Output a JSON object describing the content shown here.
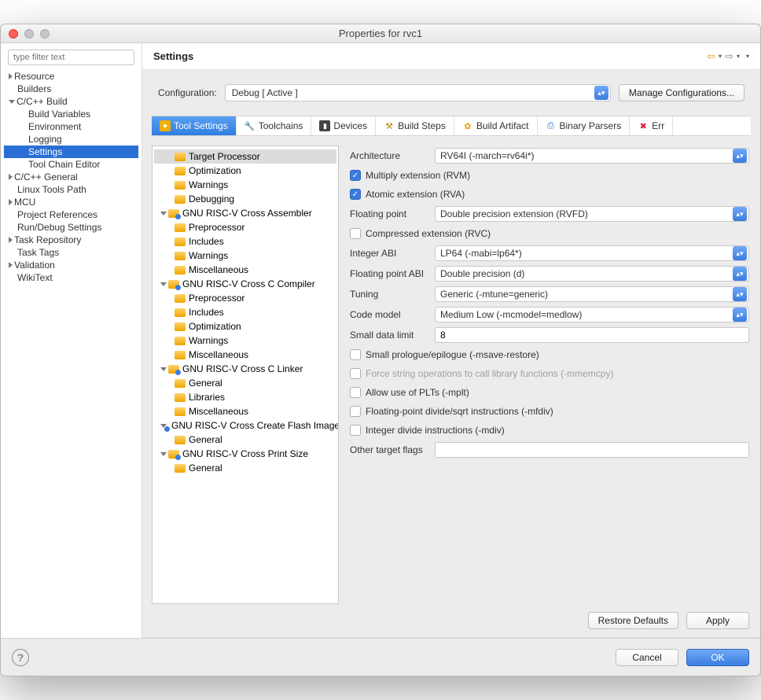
{
  "window": {
    "title": "Properties for rvc1"
  },
  "filter_placeholder": "type filter text",
  "left_tree": [
    {
      "label": "Resource",
      "indent": 0,
      "tri": "r"
    },
    {
      "label": "Builders",
      "indent": 0,
      "tri": "sp"
    },
    {
      "label": "C/C++ Build",
      "indent": 0,
      "tri": "d"
    },
    {
      "label": "Build Variables",
      "indent": 1,
      "tri": "sp"
    },
    {
      "label": "Environment",
      "indent": 1,
      "tri": "sp"
    },
    {
      "label": "Logging",
      "indent": 1,
      "tri": "sp"
    },
    {
      "label": "Settings",
      "indent": 1,
      "tri": "sp",
      "selected": true
    },
    {
      "label": "Tool Chain Editor",
      "indent": 1,
      "tri": "sp"
    },
    {
      "label": "C/C++ General",
      "indent": 0,
      "tri": "r"
    },
    {
      "label": "Linux Tools Path",
      "indent": 0,
      "tri": "sp"
    },
    {
      "label": "MCU",
      "indent": 0,
      "tri": "r"
    },
    {
      "label": "Project References",
      "indent": 0,
      "tri": "sp"
    },
    {
      "label": "Run/Debug Settings",
      "indent": 0,
      "tri": "sp"
    },
    {
      "label": "Task Repository",
      "indent": 0,
      "tri": "r"
    },
    {
      "label": "Task Tags",
      "indent": 0,
      "tri": "sp"
    },
    {
      "label": "Validation",
      "indent": 0,
      "tri": "r"
    },
    {
      "label": "WikiText",
      "indent": 0,
      "tri": "sp"
    }
  ],
  "page_title": "Settings",
  "config": {
    "label": "Configuration:",
    "value": "Debug  [ Active ]",
    "manage": "Manage Configurations..."
  },
  "tabs": [
    {
      "label": "Tool Settings",
      "ico": "tools",
      "active": true
    },
    {
      "label": "Toolchains",
      "ico": "wrench"
    },
    {
      "label": "Devices",
      "ico": "device"
    },
    {
      "label": "Build Steps",
      "ico": "hammer"
    },
    {
      "label": "Build Artifact",
      "ico": "art"
    },
    {
      "label": "Binary Parsers",
      "ico": "bin"
    },
    {
      "label": "Err",
      "ico": "err"
    }
  ],
  "mid_tree": [
    {
      "label": "Target Processor",
      "indent": 1,
      "ico": "f",
      "sel": true
    },
    {
      "label": "Optimization",
      "indent": 1,
      "ico": "f"
    },
    {
      "label": "Warnings",
      "indent": 1,
      "ico": "f"
    },
    {
      "label": "Debugging",
      "indent": 1,
      "ico": "f"
    },
    {
      "label": "GNU RISC-V Cross Assembler",
      "indent": 0,
      "ico": "b",
      "tri": "d"
    },
    {
      "label": "Preprocessor",
      "indent": 1,
      "ico": "f"
    },
    {
      "label": "Includes",
      "indent": 1,
      "ico": "f"
    },
    {
      "label": "Warnings",
      "indent": 1,
      "ico": "f"
    },
    {
      "label": "Miscellaneous",
      "indent": 1,
      "ico": "f"
    },
    {
      "label": "GNU RISC-V Cross C Compiler",
      "indent": 0,
      "ico": "b",
      "tri": "d"
    },
    {
      "label": "Preprocessor",
      "indent": 1,
      "ico": "f"
    },
    {
      "label": "Includes",
      "indent": 1,
      "ico": "f"
    },
    {
      "label": "Optimization",
      "indent": 1,
      "ico": "f"
    },
    {
      "label": "Warnings",
      "indent": 1,
      "ico": "f"
    },
    {
      "label": "Miscellaneous",
      "indent": 1,
      "ico": "f"
    },
    {
      "label": "GNU RISC-V Cross C Linker",
      "indent": 0,
      "ico": "b",
      "tri": "d"
    },
    {
      "label": "General",
      "indent": 1,
      "ico": "f"
    },
    {
      "label": "Libraries",
      "indent": 1,
      "ico": "f"
    },
    {
      "label": "Miscellaneous",
      "indent": 1,
      "ico": "f"
    },
    {
      "label": "GNU RISC-V Cross Create Flash Image",
      "indent": 0,
      "ico": "b",
      "tri": "d"
    },
    {
      "label": "General",
      "indent": 1,
      "ico": "f"
    },
    {
      "label": "GNU RISC-V Cross Print Size",
      "indent": 0,
      "ico": "b",
      "tri": "d"
    },
    {
      "label": "General",
      "indent": 1,
      "ico": "f"
    }
  ],
  "form": {
    "architecture": {
      "label": "Architecture",
      "value": "RV64I (-march=rv64i*)"
    },
    "multiply": {
      "label": "Multiply extension (RVM)",
      "checked": true
    },
    "atomic": {
      "label": "Atomic extension (RVA)",
      "checked": true
    },
    "floating": {
      "label": "Floating point",
      "value": "Double precision extension (RVFD)"
    },
    "compressed": {
      "label": "Compressed extension (RVC)",
      "checked": false
    },
    "iabi": {
      "label": "Integer ABI",
      "value": "LP64 (-mabi=lp64*)"
    },
    "fabi": {
      "label": "Floating point ABI",
      "value": "Double precision (d)"
    },
    "tuning": {
      "label": "Tuning",
      "value": "Generic (-mtune=generic)"
    },
    "codemodel": {
      "label": "Code model",
      "value": "Medium Low (-mcmodel=medlow)"
    },
    "smalldata": {
      "label": "Small data limit",
      "value": "8"
    },
    "prologue": {
      "label": "Small prologue/epilogue (-msave-restore)",
      "checked": false
    },
    "memcpy": {
      "label": "Force string operations to call library functions (-mmemcpy)",
      "checked": false,
      "disabled": true
    },
    "plt": {
      "label": "Allow use of PLTs (-mplt)",
      "checked": false
    },
    "fdiv": {
      "label": "Floating-point divide/sqrt instructions (-mfdiv)",
      "checked": false
    },
    "mdiv": {
      "label": "Integer divide instructions (-mdiv)",
      "checked": false
    },
    "otherflags": {
      "label": "Other target flags",
      "value": ""
    }
  },
  "buttons": {
    "restore": "Restore Defaults",
    "apply": "Apply",
    "cancel": "Cancel",
    "ok": "OK"
  }
}
